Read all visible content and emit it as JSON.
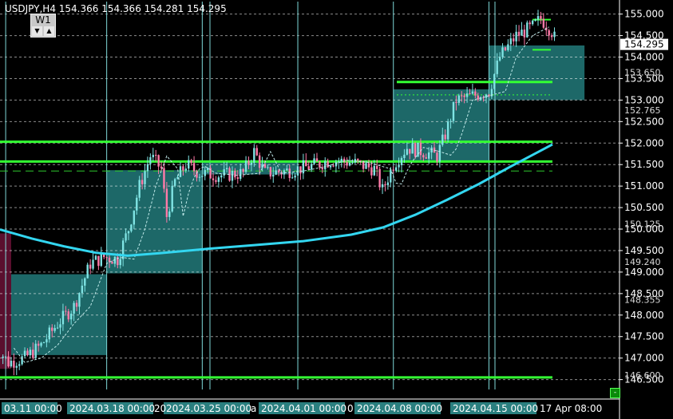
{
  "header": {
    "text": "USDJPY,H4  154.366 154.366 154.281 154.295"
  },
  "timeframe_widget": {
    "label": "W1",
    "down": "▼",
    "up": "▲"
  },
  "corner_button": {
    "label": "-"
  },
  "colors": {
    "background": "#000000",
    "grid": "#ffffff",
    "vline": "#7fd9d9",
    "bull": "#7fe3e3",
    "bear": "#ff7aa8",
    "ma": "#33d6f0",
    "zone": "#1f6e6e",
    "level": "#33ff33",
    "axis_text": "#ffffff"
  },
  "chart_data": {
    "type": "candlestick",
    "symbol": "USDJPY",
    "timeframe": "H4",
    "ylim": [
      146.27,
      155.29
    ],
    "y_ticks": [
      155.0,
      154.5,
      154.0,
      153.5,
      153.0,
      152.5,
      152.0,
      151.5,
      151.0,
      150.5,
      150.0,
      149.5,
      149.0,
      148.5,
      148.0,
      147.5,
      147.0,
      146.5
    ],
    "y_tick_labels": [
      "155.000",
      "154.500",
      "154.000",
      "153.500",
      "153.000",
      "152.500",
      "152.000",
      "151.500",
      "151.000",
      "150.500",
      "150.000",
      "149.500",
      "149.000",
      "148.500",
      "148.000",
      "147.500",
      "147.000",
      "146.500"
    ],
    "price_labels": [
      {
        "value": 154.295,
        "text": "154.295",
        "style": "current"
      },
      {
        "value": 153.65,
        "text": "153.650",
        "style": "faded"
      },
      {
        "value": 152.765,
        "text": "152.765",
        "style": "faded"
      },
      {
        "value": 150.125,
        "text": "150.125",
        "style": "faded"
      },
      {
        "value": 149.24,
        "text": "149.240",
        "style": "faded"
      },
      {
        "value": 148.355,
        "text": "148.355",
        "style": "faded"
      },
      {
        "value": 146.6,
        "text": "146.600",
        "style": "faded"
      }
    ],
    "x_labels": [
      "03.11 00:00",
      "2024.03.18 00:00",
      "2024.03.25 00:00",
      "2024.04.01 00:00",
      "2024.04.08 00:00",
      "2024.04.15 00:00",
      "17 Apr 08:00"
    ],
    "x_label_partial": [
      "20",
      "a",
      "0"
    ],
    "horizontal_levels": [
      {
        "value": 152.03,
        "style": "solid",
        "span": "full"
      },
      {
        "value": 146.55,
        "style": "solid",
        "span": "full"
      },
      {
        "value": 151.57,
        "style": "solid",
        "span": "full"
      },
      {
        "value": 151.35,
        "style": "dashed",
        "span": "full"
      },
      {
        "value": 153.42,
        "style": "solid",
        "span": "right"
      },
      {
        "value": 153.12,
        "style": "dotted",
        "span": "right"
      },
      {
        "value": 154.87,
        "style": "solid",
        "span": "short"
      },
      {
        "value": 154.17,
        "style": "solid",
        "span": "short"
      }
    ],
    "weekly_zones": [
      {
        "start": "2024.03.11",
        "end": "2024.03.18",
        "high": 148.95,
        "low": 147.07
      },
      {
        "start": "2024.03.18",
        "end": "2024.03.25",
        "high": 151.37,
        "low": 148.97
      },
      {
        "start": "2024.03.25",
        "end": "2024.04.01",
        "high": 151.59,
        "low": 151.27
      },
      {
        "start": "2024.04.08",
        "end": "2024.04.15",
        "high": 153.25,
        "low": 151.57
      },
      {
        "start": "2024.04.15",
        "end": "2024.04.22",
        "high": 154.27,
        "low": 153.0
      }
    ],
    "ma_series": [
      [
        0,
        149.99
      ],
      [
        40,
        149.78
      ],
      [
        80,
        149.6
      ],
      [
        120,
        149.45
      ],
      [
        160,
        149.38
      ],
      [
        200,
        149.44
      ],
      [
        260,
        149.54
      ],
      [
        320,
        149.63
      ],
      [
        380,
        149.72
      ],
      [
        440,
        149.87
      ],
      [
        480,
        150.04
      ],
      [
        520,
        150.33
      ],
      [
        560,
        150.68
      ],
      [
        600,
        151.05
      ],
      [
        640,
        151.46
      ],
      [
        680,
        151.85
      ],
      [
        692,
        151.97
      ]
    ],
    "series_x_units": "bars (H4)"
  }
}
